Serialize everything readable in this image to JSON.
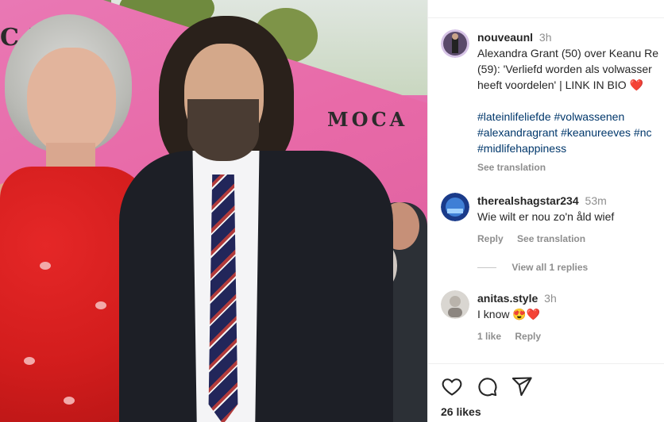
{
  "photo": {
    "sign_text_1": "MOCA",
    "sign_text_2": "CA"
  },
  "caption": {
    "username": "nouveaunl",
    "time": "3h",
    "text_line1": "Alexandra Grant (50) over Keanu Re",
    "text_line2": "(59): 'Verliefd worden als volwasser",
    "text_line3": "heeft voordelen' | LINK IN BIO",
    "hashtags_line1": "#lateinlifeliefde #volwassenen",
    "hashtags_line2": "#alexandragrant #keanureeves #nc",
    "hashtags_line3": "#midlifehappiness",
    "see_translation": "See translation",
    "heart_emoji": "❤️"
  },
  "comments": [
    {
      "username": "therealshagstar234",
      "time": "53m",
      "text": "Wie wilt er nou zo'n åld wief",
      "reply": "Reply",
      "see_translation": "See translation",
      "view_replies": "View all 1 replies"
    },
    {
      "username": "anitas.style",
      "time": "3h",
      "text": "I know",
      "emojis": "😍❤️",
      "likes": "1 like",
      "reply": "Reply"
    }
  ],
  "actions": {
    "like_icon": "heart-icon",
    "comment_icon": "comment-icon",
    "share_icon": "send-icon",
    "likes_count": "26 likes"
  },
  "colors": {
    "hashtag": "#00376b",
    "muted": "#8e8e8e",
    "text": "#262626"
  }
}
